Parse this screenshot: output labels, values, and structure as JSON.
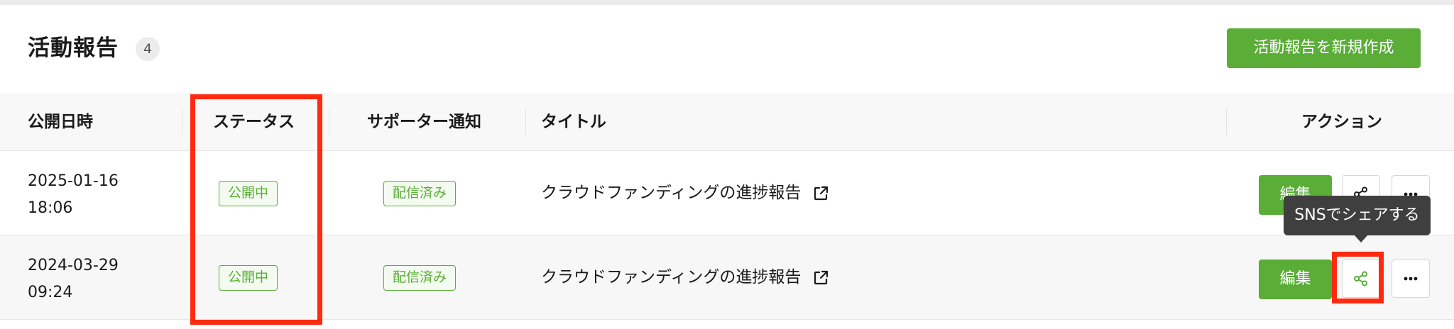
{
  "header": {
    "title": "活動報告",
    "count": "4",
    "new_button_label": "活動報告を新規作成"
  },
  "table": {
    "columns": {
      "published_at": "公開日時",
      "status": "ステータス",
      "supporter_notice": "サポーター通知",
      "title": "タイトル",
      "actions": "アクション"
    },
    "rows": [
      {
        "date": "2025-01-16",
        "time": "18:06",
        "status": "公開中",
        "notice": "配信済み",
        "title": "クラウドファンディングの進捗報告",
        "edit_label": "編集"
      },
      {
        "date": "2024-03-29",
        "time": "09:24",
        "status": "公開中",
        "notice": "配信済み",
        "title": "クラウドファンディングの進捗報告",
        "edit_label": "編集"
      }
    ]
  },
  "tooltip": {
    "text": "SNSでシェアする"
  },
  "icons": {
    "external_link": "external-link-icon",
    "share": "share-icon",
    "more": "more-horizontal-icon"
  },
  "colors": {
    "accent_green": "#5aad37",
    "highlight_red": "#ff2a0f",
    "tooltip_bg": "#3f3f3f"
  }
}
